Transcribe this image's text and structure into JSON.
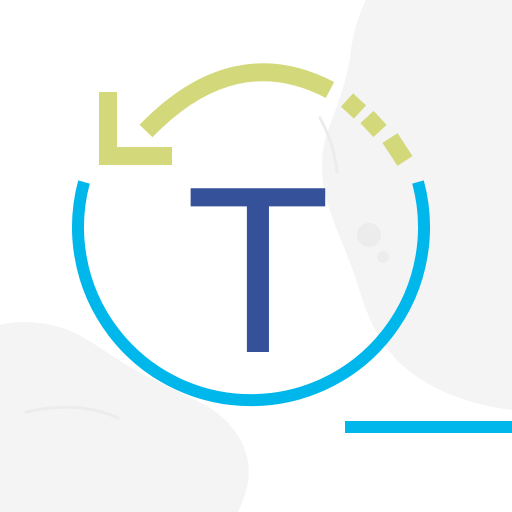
{
  "app_icon": {
    "letter": "T",
    "icon_name": "refresh-loop-icon",
    "colors": {
      "background": "#ffffff",
      "blob": "#f4f4f4",
      "blob_dark": "#ececec",
      "ring": "#00b7ec",
      "arrow": "#d3d97a",
      "letter": "#35519a"
    }
  }
}
